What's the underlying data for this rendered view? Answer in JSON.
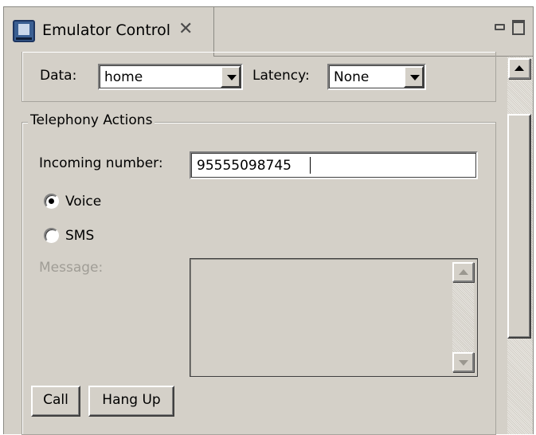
{
  "tab": {
    "title": "Emulator Control",
    "icon": "emulator-control-icon"
  },
  "network": {
    "data_label": "Data:",
    "data_value": "home",
    "latency_label": "Latency:",
    "latency_value": "None"
  },
  "telephony": {
    "legend": "Telephony Actions",
    "incoming_label": "Incoming number:",
    "incoming_value": "95555098745",
    "voice_label": "Voice",
    "sms_label": "SMS",
    "selected": "Voice",
    "message_label": "Message:",
    "call_label": "Call",
    "hangup_label": "Hang Up"
  },
  "colors": {
    "panel_bg": "#d4d0c8",
    "disabled_text": "#a09d96"
  }
}
